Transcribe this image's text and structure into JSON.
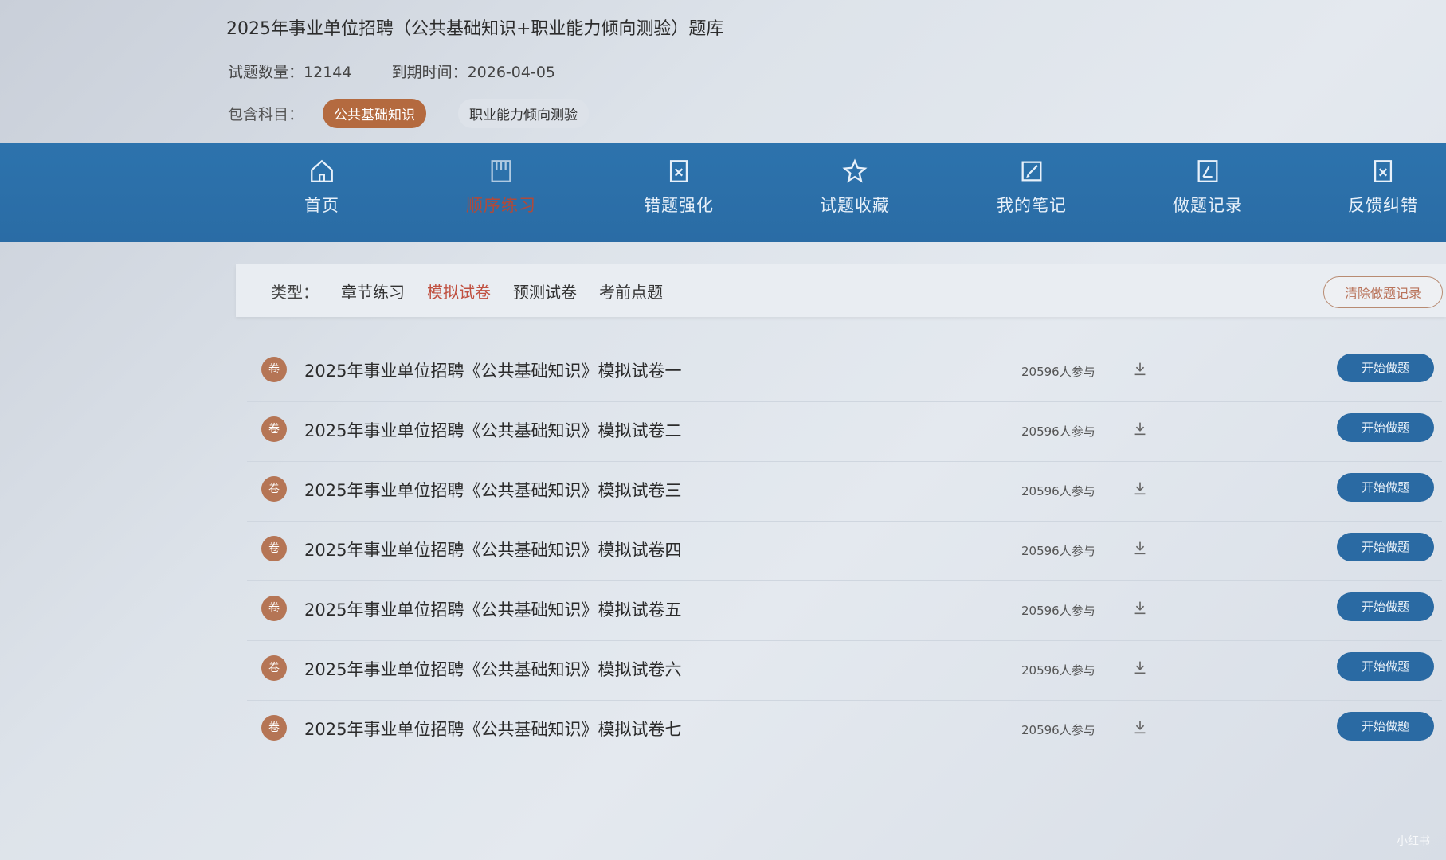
{
  "bank": {
    "title": "2025年事业单位招聘（公共基础知识+职业能力倾向测验）题库",
    "count_label": "试题数量：",
    "count_value": "12144",
    "expiry_label": "到期时间：",
    "expiry_value": "2026-04-05",
    "subjects_label": "包含科目：",
    "subjects": [
      "公共基础知识",
      "职业能力倾向测验"
    ]
  },
  "nav": {
    "items": [
      {
        "label": "首页",
        "icon": "home-icon"
      },
      {
        "label": "顺序练习",
        "icon": "book-icon"
      },
      {
        "label": "错题强化",
        "icon": "wrong-icon"
      },
      {
        "label": "试题收藏",
        "icon": "star-icon"
      },
      {
        "label": "我的笔记",
        "icon": "edit-icon"
      },
      {
        "label": "做题记录",
        "icon": "record-icon"
      },
      {
        "label": "反馈纠错",
        "icon": "feedback-icon"
      }
    ],
    "active_index": 1
  },
  "types": {
    "label": "类型：",
    "tabs": [
      "章节练习",
      "模拟试卷",
      "预测试卷",
      "考前点题"
    ],
    "active_index": 1,
    "clear_label": "清除做题记录"
  },
  "papers": [
    {
      "badge": "卷",
      "title": "2025年事业单位招聘《公共基础知识》模拟试卷一",
      "participants": "20596人参与",
      "action": "开始做题"
    },
    {
      "badge": "卷",
      "title": "2025年事业单位招聘《公共基础知识》模拟试卷二",
      "participants": "20596人参与",
      "action": "开始做题"
    },
    {
      "badge": "卷",
      "title": "2025年事业单位招聘《公共基础知识》模拟试卷三",
      "participants": "20596人参与",
      "action": "开始做题"
    },
    {
      "badge": "卷",
      "title": "2025年事业单位招聘《公共基础知识》模拟试卷四",
      "participants": "20596人参与",
      "action": "开始做题"
    },
    {
      "badge": "卷",
      "title": "2025年事业单位招聘《公共基础知识》模拟试卷五",
      "participants": "20596人参与",
      "action": "开始做题"
    },
    {
      "badge": "卷",
      "title": "2025年事业单位招聘《公共基础知识》模拟试卷六",
      "participants": "20596人参与",
      "action": "开始做题"
    },
    {
      "badge": "卷",
      "title": "2025年事业单位招聘《公共基础知识》模拟试卷七",
      "participants": "20596人参与",
      "action": "开始做题"
    }
  ],
  "colors": {
    "nav_bg": "#2a6ca5",
    "accent": "#b46a3f",
    "active_text": "#c05040",
    "button_bg": "#2a6aa3"
  },
  "watermark": "小红书"
}
